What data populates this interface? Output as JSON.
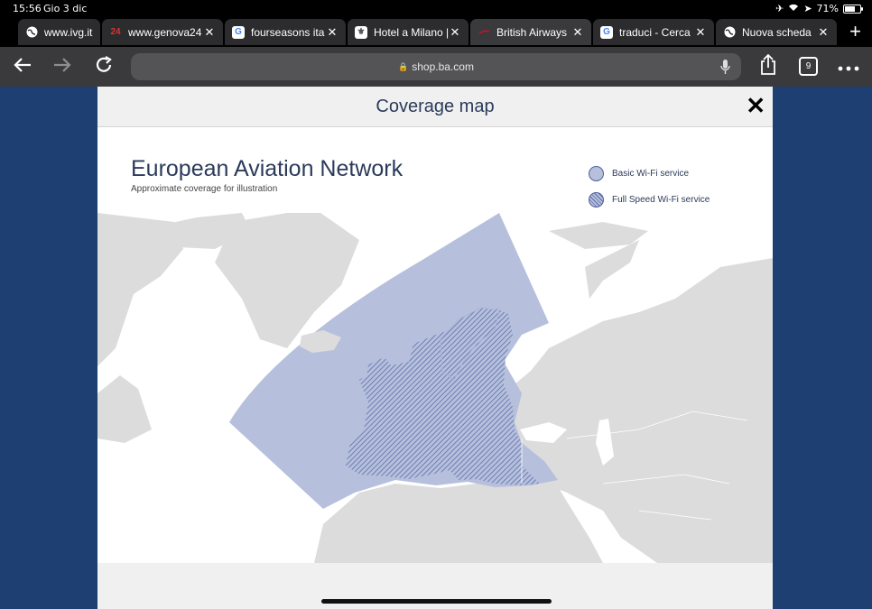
{
  "status": {
    "time": "15:56",
    "date": "Gio 3 dic",
    "battery": "71%"
  },
  "tabs": [
    {
      "title": "www.ivg.it",
      "favicon": "globe-icon"
    },
    {
      "title": "www.genova24",
      "favicon": "genova24-icon"
    },
    {
      "title": "fourseasons ita",
      "favicon": "google-icon"
    },
    {
      "title": "Hotel a Milano |",
      "favicon": "hotel-icon"
    },
    {
      "title": "British Airways",
      "favicon": "british-airways-icon",
      "active": true
    },
    {
      "title": "traduci - Cerca",
      "favicon": "google-icon"
    },
    {
      "title": "Nuova scheda",
      "favicon": "globe-icon"
    }
  ],
  "toolbar": {
    "url": "shop.ba.com",
    "tab_count": "9"
  },
  "modal": {
    "header_title": "Coverage map",
    "map_title": "European Aviation Network",
    "map_subtitle": "Approximate coverage for illustration",
    "legend": [
      {
        "label": "Basic Wi-Fi service",
        "pattern": "solid",
        "color": "#b6c0dd"
      },
      {
        "label": "Full Speed Wi-Fi service",
        "pattern": "hatched",
        "color": "#5c6ca6"
      }
    ]
  },
  "colors": {
    "land": "#dcdcdc",
    "coverage": "#b6c0dd",
    "accent": "#2b3b5a",
    "page_bg": "#1d3f72"
  }
}
